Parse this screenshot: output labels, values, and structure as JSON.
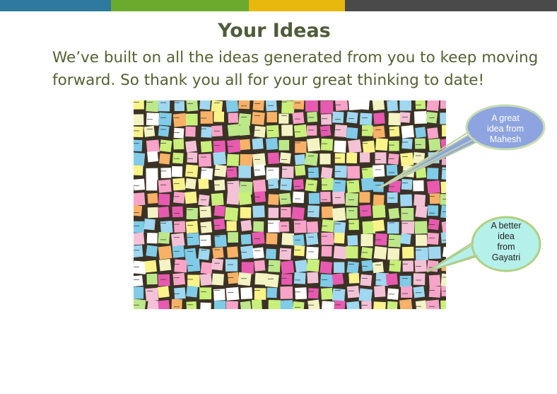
{
  "colors": {
    "bar": [
      "#2e7a9e",
      "#6aab2e",
      "#e8b90c",
      "#4a4a4a"
    ],
    "title": "#4f5b3a",
    "body": "#55612f",
    "callout_1": "#8ea4e0",
    "callout_2": "#b6f0ea"
  },
  "slide": {
    "title": "Your Ideas",
    "body": "We’ve built on all the ideas generated from you to keep moving forward. So thank you all for your great thinking to date!"
  },
  "photo": {
    "subject": "wall of colorful sticky notes"
  },
  "callouts": [
    {
      "lines": [
        "A great",
        "idea from",
        "Mahesh"
      ]
    },
    {
      "lines": [
        "A better",
        "idea",
        "from",
        "Gayatri"
      ]
    }
  ]
}
